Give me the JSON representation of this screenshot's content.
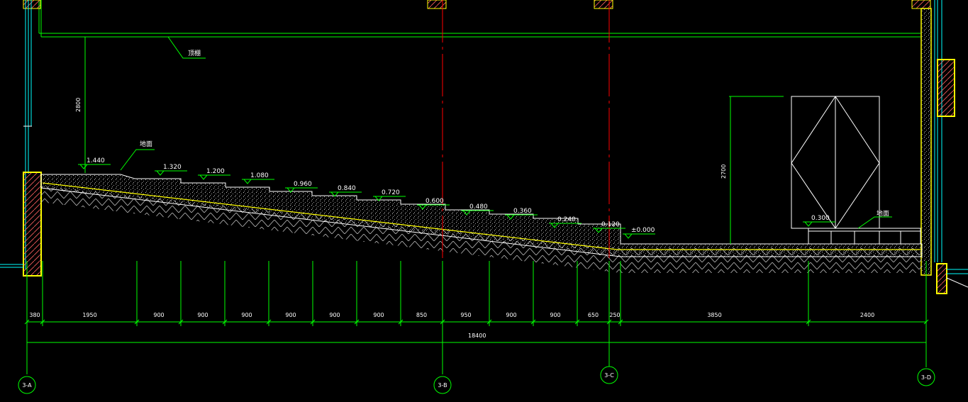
{
  "annotations": {
    "ceiling_label": "顶棚",
    "floor_label_left": "地面",
    "floor_label_right": "地面",
    "height_left": "2800",
    "height_right": "2700"
  },
  "elevations": [
    "1.440",
    "1.320",
    "1.200",
    "1.080",
    "0.960",
    "0.840",
    "0.720",
    "0.600",
    "0.480",
    "0.360",
    "0.240",
    "0.120",
    "±0.000",
    "0.300"
  ],
  "dimensions": [
    "380",
    "1950",
    "900",
    "900",
    "900",
    "900",
    "900",
    "900",
    "850",
    "950",
    "900",
    "900",
    "650",
    "250",
    "3850",
    "2400"
  ],
  "total_dimension": "18400",
  "axes": [
    "3-A",
    "3-B",
    "3-C",
    "3-D"
  ],
  "colors": {
    "background": "#000000",
    "dimension_line": "#00ff00",
    "wall_outline": "#ffff00",
    "axis_line": "#ff0000",
    "text": "#ffffff",
    "window": "#00ffff"
  }
}
